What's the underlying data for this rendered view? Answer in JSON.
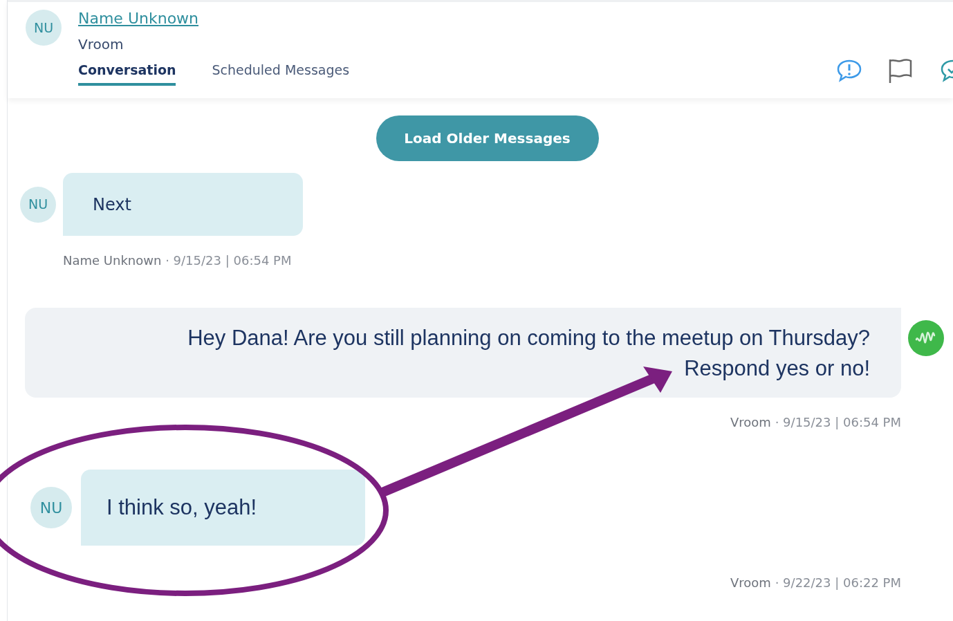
{
  "contact": {
    "initials": "NU",
    "name": "Name Unknown",
    "organization": "Vroom"
  },
  "tabs": [
    {
      "label": "Conversation",
      "selected": true
    },
    {
      "label": "Scheduled Messages",
      "selected": false
    }
  ],
  "load_button": "Load Older Messages",
  "messages": [
    {
      "kind": "incoming",
      "initials": "NU",
      "text": "Next",
      "sender": "Name Unknown",
      "separator": "·",
      "timestamp": "9/15/23 | 06:54 PM"
    },
    {
      "kind": "outgoing",
      "text": "Hey Dana! Are you still planning on coming to the meetup on Thursday? Respond yes or no!",
      "sender": "Vroom",
      "separator": "·",
      "timestamp": "9/15/23 | 06:54 PM"
    },
    {
      "kind": "reply",
      "initials": "NU",
      "text": "I think so, yeah!",
      "sender": "Vroom",
      "separator": "·",
      "timestamp": "9/22/23 | 06:22 PM"
    }
  ]
}
